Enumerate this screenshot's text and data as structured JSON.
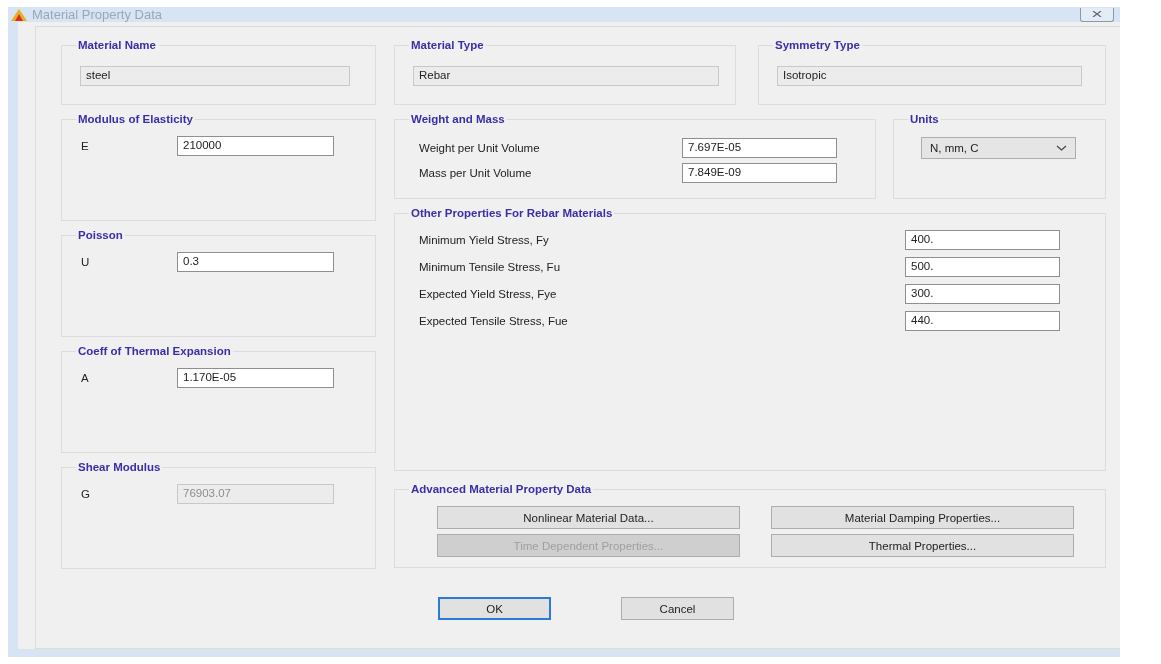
{
  "window": {
    "title": "Material Property Data"
  },
  "top_fields": [
    {
      "title": "Material Name",
      "value": "steel",
      "disabled": true
    },
    {
      "title": "Material Type",
      "value": "Rebar",
      "disabled": true
    },
    {
      "title": "Symmetry Type",
      "value": "Isotropic",
      "disabled": true
    }
  ],
  "left_groups": [
    {
      "title": "Modulus of Elasticity",
      "symbol": "E",
      "value": "210000",
      "disabled": false
    },
    {
      "title": "Poisson",
      "symbol": "U",
      "value": "0.3",
      "disabled": false
    },
    {
      "title": "Coeff of Thermal Expansion",
      "symbol": "A",
      "value": "1.170E-05",
      "disabled": false
    },
    {
      "title": "Shear Modulus",
      "symbol": "G",
      "value": "76903.07",
      "disabled": true
    }
  ],
  "weight_and_mass": {
    "title": "Weight and Mass",
    "rows": [
      {
        "label": "Weight per Unit Volume",
        "value": "7.697E-05"
      },
      {
        "label": "Mass per Unit Volume",
        "value": "7.849E-09"
      }
    ]
  },
  "units": {
    "title": "Units",
    "value": "N, mm, C"
  },
  "other_properties": {
    "title": "Other Properties For Rebar Materials",
    "rows": [
      {
        "label": "Minimum Yield Stress, Fy",
        "value": "400."
      },
      {
        "label": "Minimum Tensile Stress, Fu",
        "value": "500."
      },
      {
        "label": "Expected Yield Stress, Fye",
        "value": "300."
      },
      {
        "label": "Expected Tensile Stress, Fue",
        "value": "440."
      }
    ]
  },
  "advanced": {
    "title": "Advanced Material Property Data",
    "buttons": [
      {
        "label": "Nonlinear Material Data...",
        "disabled": false
      },
      {
        "label": "Material Damping Properties...",
        "disabled": false
      },
      {
        "label": "Time Dependent Properties...",
        "disabled": true
      },
      {
        "label": "Thermal Properties...",
        "disabled": false
      }
    ]
  },
  "buttons": [
    {
      "label": "OK",
      "focused": true
    },
    {
      "label": "Cancel",
      "focused": false
    }
  ]
}
